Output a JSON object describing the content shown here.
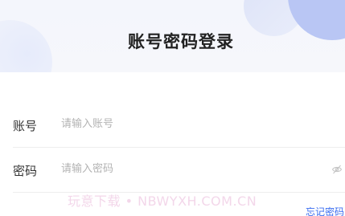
{
  "header": {
    "title": "账号密码登录"
  },
  "form": {
    "account": {
      "label": "账号",
      "placeholder": "请输入账号"
    },
    "password": {
      "label": "密码",
      "placeholder": "请输入密码",
      "visibility_icon": "eye-off-icon"
    },
    "forgot_password": "忘记密码"
  },
  "watermark": "玩意下载 • NBWYXH.COM.CN",
  "colors": {
    "accent": "#3a6df0",
    "title": "#222222",
    "label": "#333333",
    "placeholder": "#b3b3b3"
  }
}
